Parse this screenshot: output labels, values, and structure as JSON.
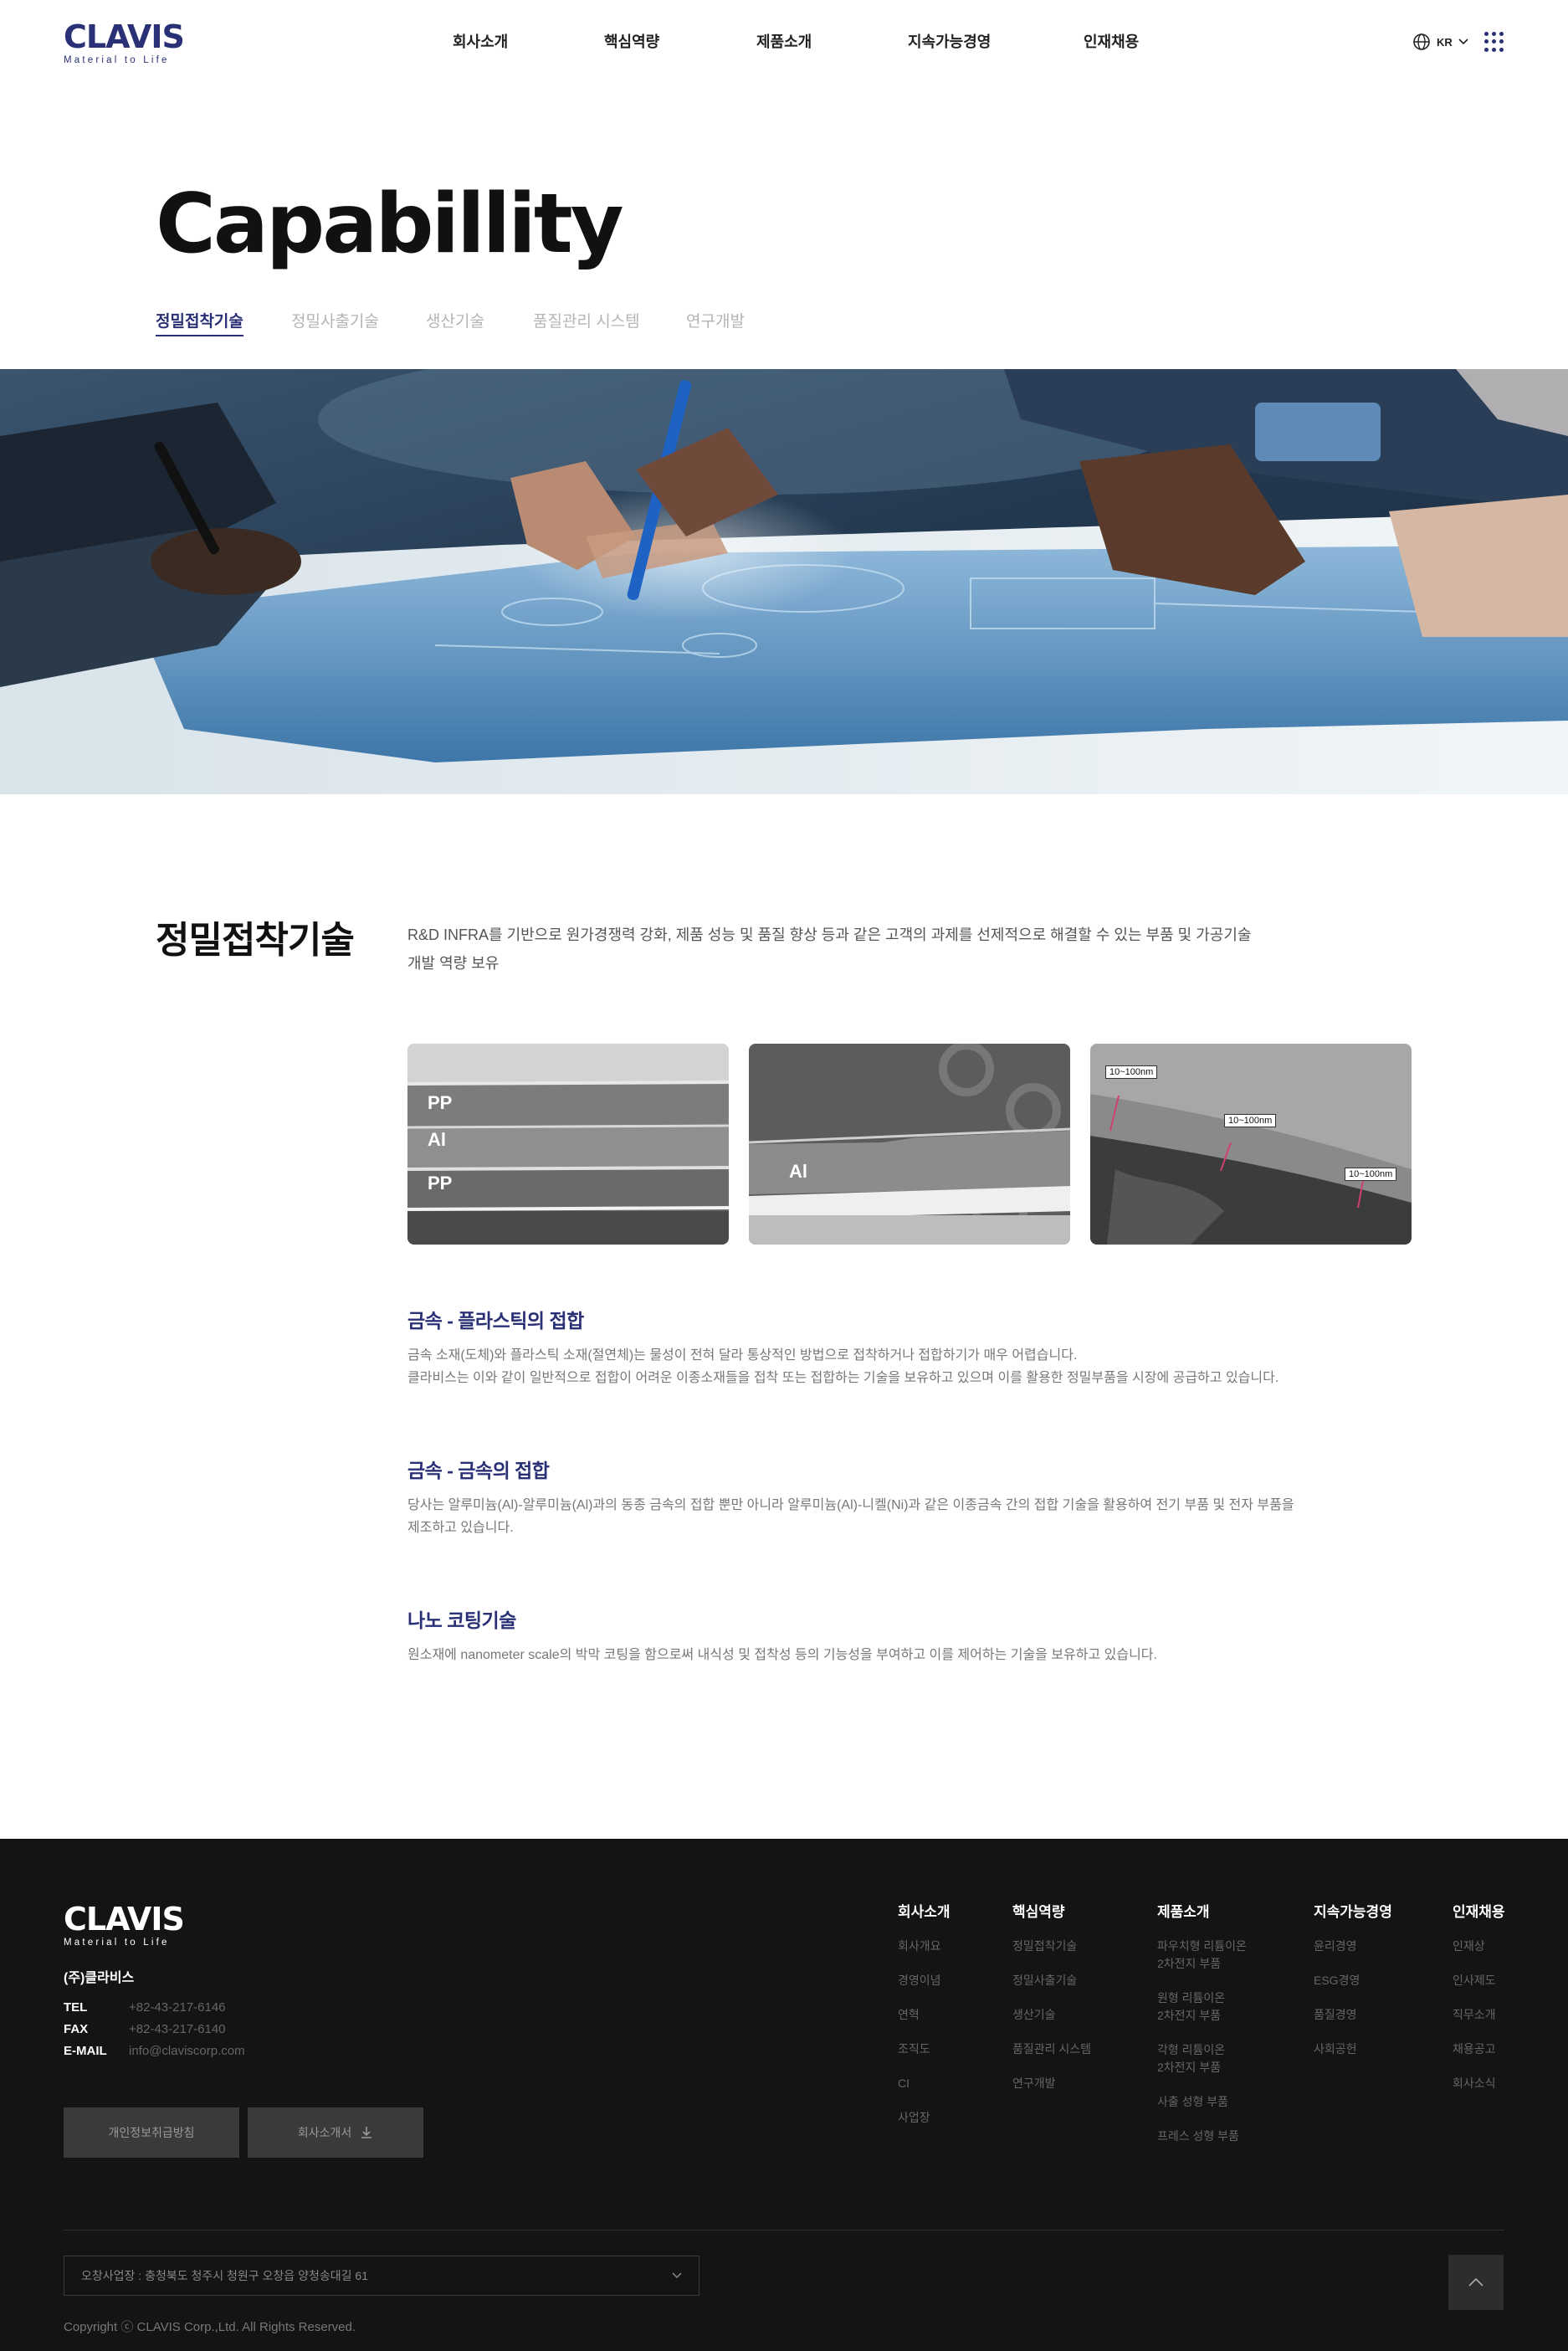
{
  "header": {
    "logo": {
      "word": "CLAVIS",
      "tagline": "Material to Life"
    },
    "nav": [
      "회사소개",
      "핵심역량",
      "제품소개",
      "지속가능경영",
      "인재채용"
    ],
    "lang": "KR",
    "icons": {
      "globe": "globe-icon",
      "chevron": "chevron-down-icon",
      "menu": "grid-menu-icon"
    }
  },
  "page": {
    "title": "Capabillity",
    "tabs": [
      "정밀접착기술",
      "정밀사출기술",
      "생산기술",
      "품질관리 시스템",
      "연구개발"
    ],
    "active_tab": "정밀접착기술"
  },
  "section": {
    "title": "정밀접착기술",
    "desc_line1": "R&D INFRA를 기반으로 원가경쟁력 강화, 제품 성능 및 품질 향상 등과 같은 고객의 과제를 선제적으로 해결할 수 있는 부품 및 가공기술",
    "desc_line2": "개발 역량 보유",
    "photo1": [
      "PP",
      "Al",
      "PP"
    ],
    "photo2": [
      "Al"
    ],
    "photo3": [
      "10~100nm",
      "10~100nm",
      "10~100nm"
    ],
    "items": [
      {
        "title": "금속 - 플라스틱의 접합",
        "line1": "금속 소재(도체)와 플라스틱 소재(절연체)는 물성이 전혀 달라 통상적인 방법으로 접착하거나 접합하기가 매우 어렵습니다.",
        "line2": "클라비스는 이와 같이 일반적으로 접합이 어려운 이종소재들을 접착 또는 접합하는 기술을 보유하고 있으며 이를 활용한 정밀부품을 시장에 공급하고 있습니다."
      },
      {
        "title": "금속 - 금속의 접합",
        "line1": "당사는 알루미늄(Al)-알루미늄(Al)과의 동종 금속의 접합 뿐만 아니라 알루미늄(Al)-니켈(Ni)과 같은 이종금속 간의 접합 기술을 활용하여 전기 부품 및 전자 부품을",
        "line2": "제조하고 있습니다."
      },
      {
        "title": "나노 코팅기술",
        "line1": "원소재에 nanometer scale의 박막 코팅을 함으로써 내식성 및 접착성 등의 기능성을 부여하고 이를 제어하는 기술을 보유하고 있습니다.",
        "line2": ""
      }
    ]
  },
  "footer": {
    "logo": {
      "word": "CLAVIS",
      "tagline": "Material to Life"
    },
    "company": "(주)클라비스",
    "contact": [
      {
        "label": "TEL",
        "value": "+82-43-217-6146"
      },
      {
        "label": "FAX",
        "value": "+82-43-217-6140"
      },
      {
        "label": "E-MAIL",
        "value": "info@claviscorp.com"
      }
    ],
    "buttons": {
      "privacy": "개인정보취급방침",
      "brochure": "회사소개서"
    },
    "columns": [
      {
        "title": "회사소개",
        "links": [
          "회사개요",
          "경영이념",
          "연혁",
          "조직도",
          "CI",
          "사업장"
        ]
      },
      {
        "title": "핵심역량",
        "links": [
          "정밀접착기술",
          "정밀사출기술",
          "생산기술",
          "품질관리 시스템",
          "연구개발"
        ]
      },
      {
        "title": "제품소개",
        "links": [
          "파우치형 리튬이온|2차전지 부품",
          "원형 리튬이온|2차전지 부품",
          "각형 리튬이온|2차전지 부품",
          "사출 성형 부품",
          "프레스 성형 부품"
        ]
      },
      {
        "title": "지속가능경영",
        "links": [
          "윤리경영",
          "ESG경영",
          "품질경영",
          "사회공헌"
        ]
      },
      {
        "title": "인재채용",
        "links": [
          "인재상",
          "인사제도",
          "직무소개",
          "채용공고",
          "회사소식"
        ]
      }
    ],
    "address": "오창사업장 : 충청북도 청주시 청원구 오창읍 양청송대길 61",
    "copyright": "Copyright ⓒ CLAVIS Corp.,Ltd. All Rights Reserved."
  }
}
